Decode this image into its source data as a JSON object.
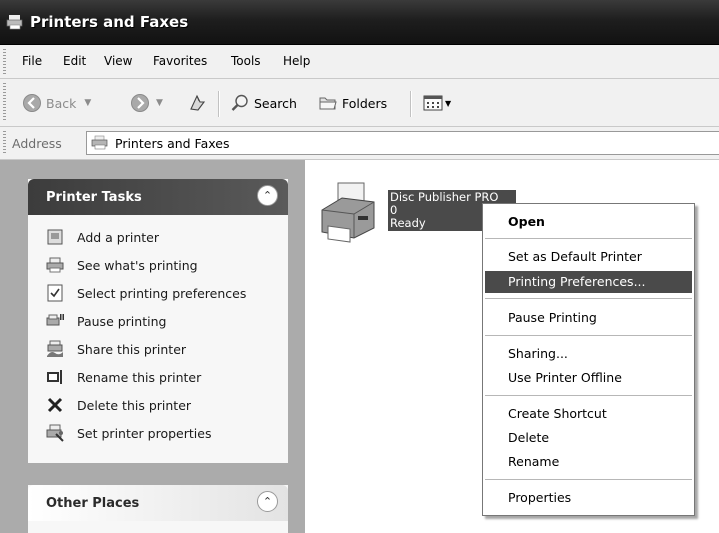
{
  "window": {
    "title": "Printers and Faxes"
  },
  "menu": [
    "File",
    "Edit",
    "View",
    "Favorites",
    "Tools",
    "Help"
  ],
  "toolbar": {
    "back": "Back",
    "search": "Search",
    "folders": "Folders"
  },
  "address": {
    "label": "Address",
    "value": "Printers and Faxes"
  },
  "printer_tasks": {
    "title": "Printer Tasks",
    "items": [
      {
        "label": "Add a printer",
        "icon": "add-printer-icon"
      },
      {
        "label": "See what's printing",
        "icon": "print-queue-icon"
      },
      {
        "label": "Select printing preferences",
        "icon": "preferences-icon"
      },
      {
        "label": "Pause printing",
        "icon": "pause-printer-icon"
      },
      {
        "label": "Share this printer",
        "icon": "share-printer-icon"
      },
      {
        "label": "Rename this printer",
        "icon": "rename-icon"
      },
      {
        "label": "Delete this printer",
        "icon": "delete-x-icon"
      },
      {
        "label": "Set printer properties",
        "icon": "properties-icon"
      }
    ]
  },
  "other_places": {
    "title": "Other Places"
  },
  "printer": {
    "name": "Disc Publisher PRO",
    "jobs": "0",
    "status": "Ready"
  },
  "context_menu": {
    "open": "Open",
    "set_default": "Set as Default Printer",
    "printing_prefs": "Printing Preferences...",
    "pause": "Pause Printing",
    "sharing": "Sharing...",
    "offline": "Use Printer Offline",
    "shortcut": "Create Shortcut",
    "delete": "Delete",
    "rename": "Rename",
    "properties": "Properties"
  }
}
